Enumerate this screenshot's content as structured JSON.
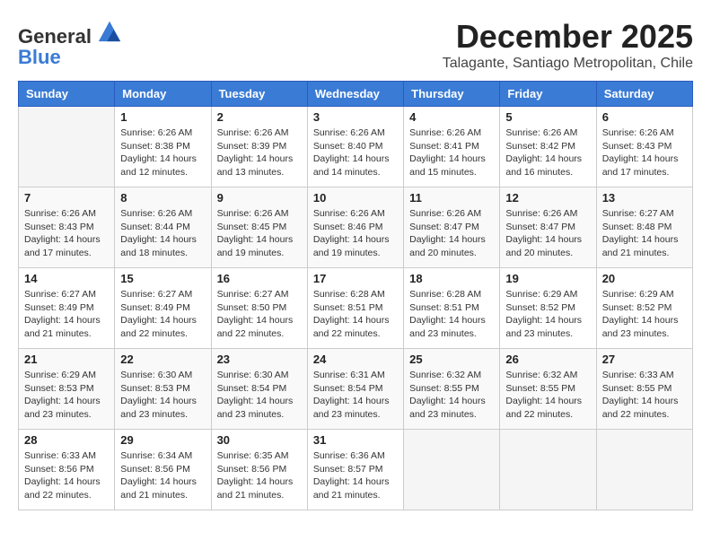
{
  "header": {
    "logo_general": "General",
    "logo_blue": "Blue",
    "month": "December 2025",
    "location": "Talagante, Santiago Metropolitan, Chile"
  },
  "weekdays": [
    "Sunday",
    "Monday",
    "Tuesday",
    "Wednesday",
    "Thursday",
    "Friday",
    "Saturday"
  ],
  "weeks": [
    [
      {
        "day": "",
        "info": ""
      },
      {
        "day": "1",
        "info": "Sunrise: 6:26 AM\nSunset: 8:38 PM\nDaylight: 14 hours\nand 12 minutes."
      },
      {
        "day": "2",
        "info": "Sunrise: 6:26 AM\nSunset: 8:39 PM\nDaylight: 14 hours\nand 13 minutes."
      },
      {
        "day": "3",
        "info": "Sunrise: 6:26 AM\nSunset: 8:40 PM\nDaylight: 14 hours\nand 14 minutes."
      },
      {
        "day": "4",
        "info": "Sunrise: 6:26 AM\nSunset: 8:41 PM\nDaylight: 14 hours\nand 15 minutes."
      },
      {
        "day": "5",
        "info": "Sunrise: 6:26 AM\nSunset: 8:42 PM\nDaylight: 14 hours\nand 16 minutes."
      },
      {
        "day": "6",
        "info": "Sunrise: 6:26 AM\nSunset: 8:43 PM\nDaylight: 14 hours\nand 17 minutes."
      }
    ],
    [
      {
        "day": "7",
        "info": "Sunrise: 6:26 AM\nSunset: 8:43 PM\nDaylight: 14 hours\nand 17 minutes."
      },
      {
        "day": "8",
        "info": "Sunrise: 6:26 AM\nSunset: 8:44 PM\nDaylight: 14 hours\nand 18 minutes."
      },
      {
        "day": "9",
        "info": "Sunrise: 6:26 AM\nSunset: 8:45 PM\nDaylight: 14 hours\nand 19 minutes."
      },
      {
        "day": "10",
        "info": "Sunrise: 6:26 AM\nSunset: 8:46 PM\nDaylight: 14 hours\nand 19 minutes."
      },
      {
        "day": "11",
        "info": "Sunrise: 6:26 AM\nSunset: 8:47 PM\nDaylight: 14 hours\nand 20 minutes."
      },
      {
        "day": "12",
        "info": "Sunrise: 6:26 AM\nSunset: 8:47 PM\nDaylight: 14 hours\nand 20 minutes."
      },
      {
        "day": "13",
        "info": "Sunrise: 6:27 AM\nSunset: 8:48 PM\nDaylight: 14 hours\nand 21 minutes."
      }
    ],
    [
      {
        "day": "14",
        "info": "Sunrise: 6:27 AM\nSunset: 8:49 PM\nDaylight: 14 hours\nand 21 minutes."
      },
      {
        "day": "15",
        "info": "Sunrise: 6:27 AM\nSunset: 8:49 PM\nDaylight: 14 hours\nand 22 minutes."
      },
      {
        "day": "16",
        "info": "Sunrise: 6:27 AM\nSunset: 8:50 PM\nDaylight: 14 hours\nand 22 minutes."
      },
      {
        "day": "17",
        "info": "Sunrise: 6:28 AM\nSunset: 8:51 PM\nDaylight: 14 hours\nand 22 minutes."
      },
      {
        "day": "18",
        "info": "Sunrise: 6:28 AM\nSunset: 8:51 PM\nDaylight: 14 hours\nand 23 minutes."
      },
      {
        "day": "19",
        "info": "Sunrise: 6:29 AM\nSunset: 8:52 PM\nDaylight: 14 hours\nand 23 minutes."
      },
      {
        "day": "20",
        "info": "Sunrise: 6:29 AM\nSunset: 8:52 PM\nDaylight: 14 hours\nand 23 minutes."
      }
    ],
    [
      {
        "day": "21",
        "info": "Sunrise: 6:29 AM\nSunset: 8:53 PM\nDaylight: 14 hours\nand 23 minutes."
      },
      {
        "day": "22",
        "info": "Sunrise: 6:30 AM\nSunset: 8:53 PM\nDaylight: 14 hours\nand 23 minutes."
      },
      {
        "day": "23",
        "info": "Sunrise: 6:30 AM\nSunset: 8:54 PM\nDaylight: 14 hours\nand 23 minutes."
      },
      {
        "day": "24",
        "info": "Sunrise: 6:31 AM\nSunset: 8:54 PM\nDaylight: 14 hours\nand 23 minutes."
      },
      {
        "day": "25",
        "info": "Sunrise: 6:32 AM\nSunset: 8:55 PM\nDaylight: 14 hours\nand 23 minutes."
      },
      {
        "day": "26",
        "info": "Sunrise: 6:32 AM\nSunset: 8:55 PM\nDaylight: 14 hours\nand 22 minutes."
      },
      {
        "day": "27",
        "info": "Sunrise: 6:33 AM\nSunset: 8:55 PM\nDaylight: 14 hours\nand 22 minutes."
      }
    ],
    [
      {
        "day": "28",
        "info": "Sunrise: 6:33 AM\nSunset: 8:56 PM\nDaylight: 14 hours\nand 22 minutes."
      },
      {
        "day": "29",
        "info": "Sunrise: 6:34 AM\nSunset: 8:56 PM\nDaylight: 14 hours\nand 21 minutes."
      },
      {
        "day": "30",
        "info": "Sunrise: 6:35 AM\nSunset: 8:56 PM\nDaylight: 14 hours\nand 21 minutes."
      },
      {
        "day": "31",
        "info": "Sunrise: 6:36 AM\nSunset: 8:57 PM\nDaylight: 14 hours\nand 21 minutes."
      },
      {
        "day": "",
        "info": ""
      },
      {
        "day": "",
        "info": ""
      },
      {
        "day": "",
        "info": ""
      }
    ]
  ]
}
